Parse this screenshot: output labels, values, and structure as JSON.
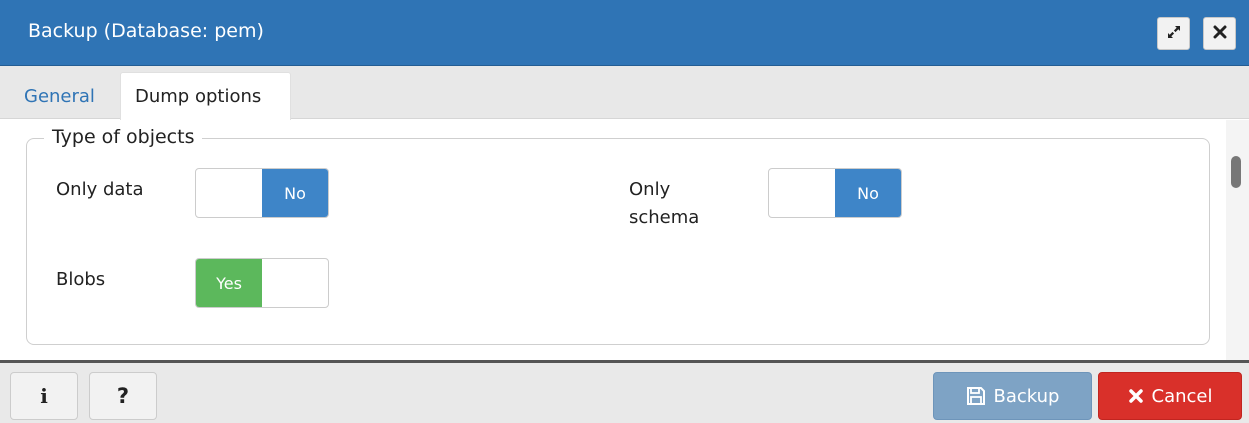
{
  "dialog": {
    "title": "Backup (Database: pem)",
    "maximize_icon": "expand-arrows-icon",
    "close_icon": "close-icon"
  },
  "tabs": [
    {
      "label": "General",
      "active": false
    },
    {
      "label": "Dump options",
      "active": true
    }
  ],
  "type_of_objects": {
    "legend": "Type of objects",
    "only_data": {
      "label": "Only data",
      "value": "No"
    },
    "only_schema": {
      "label_line1": "Only",
      "label_line2": "schema",
      "value": "No"
    },
    "blobs": {
      "label": "Blobs",
      "value": "Yes"
    }
  },
  "footer": {
    "info_label": "i",
    "help_label": "?",
    "backup_label": "Backup",
    "backup_icon": "floppy-disk-icon",
    "cancel_label": "Cancel",
    "cancel_icon": "x-icon"
  },
  "colors": {
    "titlebar": "#2f74b5",
    "toggle_no": "#3e85c8",
    "toggle_yes": "#5cb85c",
    "backup_button": "#7ea3c5",
    "cancel_button": "#d9302a"
  }
}
